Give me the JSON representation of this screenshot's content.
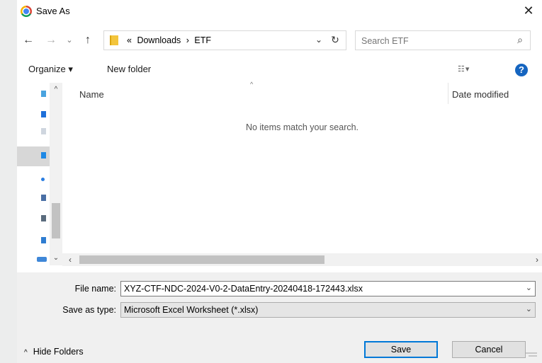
{
  "window": {
    "title": "Save As",
    "close_glyph": "✕",
    "icon": "chrome-icon"
  },
  "nav": {
    "back": "←",
    "forward": "→",
    "recent_dropdown": "⌄",
    "up": "↑",
    "breadcrumb_prefix": "«",
    "breadcrumbs": [
      "Downloads",
      "ETF"
    ],
    "separator": "›",
    "address_dropdown": "⌄",
    "refresh": "↻",
    "search_placeholder": "Search ETF",
    "search_glyph": "⌕"
  },
  "toolbar": {
    "organize": "Organize ▾",
    "new_folder": "New folder",
    "view_glyph": "☷ ▾",
    "help": "?"
  },
  "file_list": {
    "columns": [
      "Name",
      "Date modified"
    ],
    "sort_indicator": "^",
    "empty_message": "No items match your search."
  },
  "form": {
    "file_name_label": "File name:",
    "file_name_value": "XYZ-CTF-NDC-2024-V0-2-DataEntry-20240418-172443.xlsx",
    "save_type_label": "Save as type:",
    "save_type_value": "Microsoft Excel Worksheet (*.xlsx)",
    "dropdown_glyph": "⌄"
  },
  "footer": {
    "hide_folders": "Hide Folders",
    "caret": "^",
    "save": "Save",
    "cancel": "Cancel"
  },
  "colors": {
    "accent": "#0078d7",
    "help": "#1565c0",
    "folder": "#f3c53c"
  }
}
